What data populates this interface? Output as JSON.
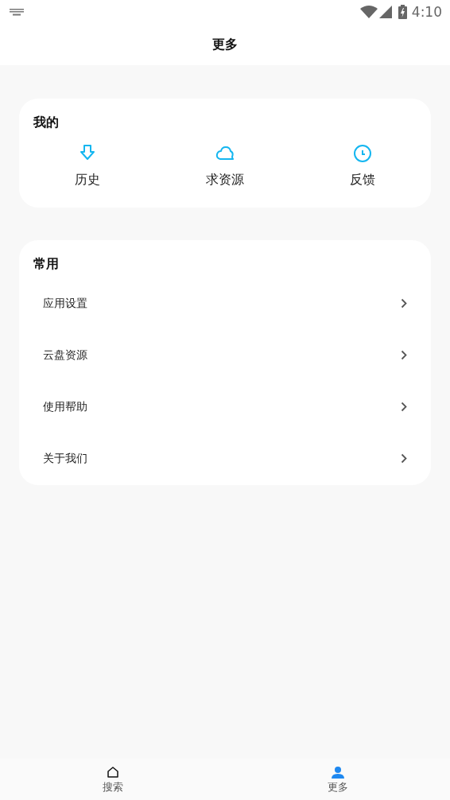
{
  "status_bar": {
    "time": "4:10"
  },
  "header": {
    "title": "更多"
  },
  "mine": {
    "title": "我的",
    "items": [
      {
        "label": "历史"
      },
      {
        "label": "求资源"
      },
      {
        "label": "反馈"
      }
    ]
  },
  "common": {
    "title": "常用",
    "items": [
      {
        "label": "应用设置"
      },
      {
        "label": "云盘资源"
      },
      {
        "label": "使用帮助"
      },
      {
        "label": "关于我们"
      }
    ]
  },
  "tabs": [
    {
      "label": "搜索",
      "selected": false
    },
    {
      "label": "更多",
      "selected": true
    }
  ]
}
